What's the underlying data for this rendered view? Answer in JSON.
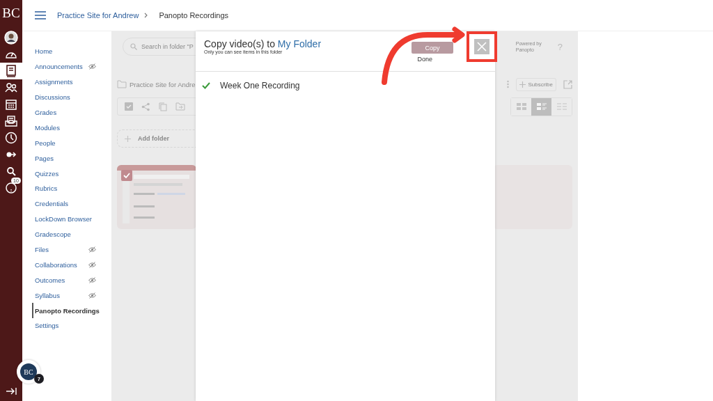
{
  "rail": {
    "logo": "BC",
    "items": [
      {
        "kind": "account",
        "selected": false
      },
      {
        "kind": "dashboard",
        "selected": false
      },
      {
        "kind": "courses",
        "selected": true
      },
      {
        "kind": "groups",
        "selected": false
      },
      {
        "kind": "calendar",
        "selected": false
      },
      {
        "kind": "inbox",
        "selected": false
      },
      {
        "kind": "history",
        "selected": false
      },
      {
        "kind": "commons",
        "selected": false
      },
      {
        "kind": "search",
        "selected": false
      },
      {
        "kind": "help",
        "selected": false,
        "badge": "10"
      }
    ]
  },
  "header": {
    "breadcrumbs": [
      "Practice Site for Andrew",
      "Panopto Recordings"
    ]
  },
  "course_nav": {
    "items": [
      {
        "label": "Home",
        "hidden": false,
        "selected": false
      },
      {
        "label": "Announcements",
        "hidden": true,
        "selected": false
      },
      {
        "label": "Assignments",
        "hidden": false,
        "selected": false
      },
      {
        "label": "Discussions",
        "hidden": false,
        "selected": false
      },
      {
        "label": "Grades",
        "hidden": false,
        "selected": false
      },
      {
        "label": "Modules",
        "hidden": false,
        "selected": false
      },
      {
        "label": "People",
        "hidden": false,
        "selected": false
      },
      {
        "label": "Pages",
        "hidden": false,
        "selected": false
      },
      {
        "label": "Quizzes",
        "hidden": false,
        "selected": false
      },
      {
        "label": "Rubrics",
        "hidden": false,
        "selected": false
      },
      {
        "label": "Credentials",
        "hidden": false,
        "selected": false
      },
      {
        "label": "LockDown Browser",
        "hidden": false,
        "selected": false
      },
      {
        "label": "Gradescope",
        "hidden": false,
        "selected": false
      },
      {
        "label": "Files",
        "hidden": true,
        "selected": false
      },
      {
        "label": "Collaborations",
        "hidden": true,
        "selected": false
      },
      {
        "label": "Outcomes",
        "hidden": true,
        "selected": false
      },
      {
        "label": "Syllabus",
        "hidden": true,
        "selected": false
      },
      {
        "label": "Panopto Recordings",
        "hidden": false,
        "selected": true
      },
      {
        "label": "Settings",
        "hidden": false,
        "selected": false
      }
    ]
  },
  "helper_avatar": {
    "initials": "BC",
    "badge": "7"
  },
  "panopto": {
    "search": {
      "placeholder": "Search in folder \"P"
    },
    "folder_path": "Practice Site for Andre",
    "powered_by": "Powered by Panopto",
    "help": "?",
    "subscribe": "Subscribe",
    "add_folder": "Add folder",
    "views": [
      {
        "kind": "thumbnails",
        "selected": false
      },
      {
        "kind": "details",
        "selected": true
      },
      {
        "kind": "list",
        "selected": false
      }
    ],
    "thumbnail": {
      "kind": "picture",
      "checked": true
    }
  },
  "modal": {
    "title": "Copy video(s) to",
    "folder": "My Folder",
    "subtitle": "Only you can see items in this folder",
    "copy_button": "Copy",
    "done": "Done",
    "items": [
      {
        "title": "Week One Recording",
        "done": true
      }
    ]
  }
}
